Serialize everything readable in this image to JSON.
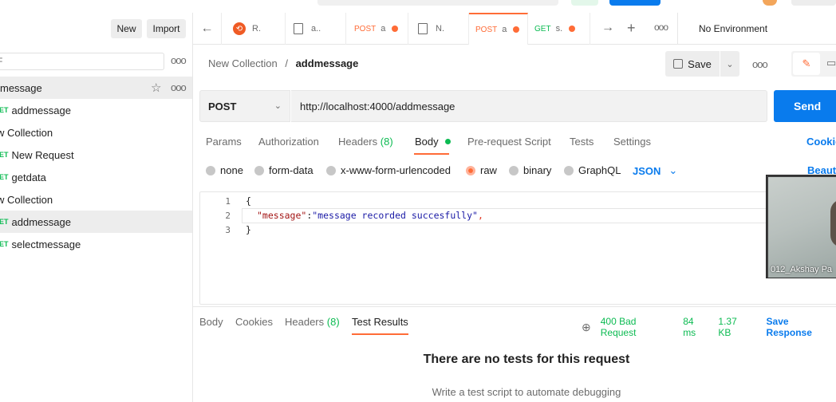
{
  "sidebar": {
    "new_label": "New",
    "import_label": "Import",
    "filter_glyph": "F",
    "more_glyph": "ooo",
    "items": [
      {
        "method": "",
        "label": "message",
        "selected": true
      },
      {
        "method": "GET",
        "label": "addmessage",
        "selected": false
      },
      {
        "method": "",
        "label": "w Collection",
        "selected": false
      },
      {
        "method": "GET",
        "label": "New Request",
        "selected": false
      },
      {
        "method": "GET",
        "label": "getdata",
        "selected": false
      },
      {
        "method": "",
        "label": "w Collection",
        "selected": false
      },
      {
        "method": "GET",
        "label": "addmessage",
        "selected": true
      },
      {
        "method": "GET",
        "label": "selectmessage",
        "selected": false
      }
    ]
  },
  "tabs": {
    "items": [
      {
        "method": "",
        "label": "R."
      },
      {
        "method": "",
        "label": "a.."
      },
      {
        "method": "POST",
        "label": "a"
      },
      {
        "method": "",
        "label": "N."
      },
      {
        "method": "POST",
        "label": "a"
      },
      {
        "method": "GET",
        "label": "s."
      }
    ],
    "environment": "No Environment"
  },
  "breadcrumb": {
    "collection": "New Collection",
    "separator": "/",
    "request": "addmessage"
  },
  "toolbar": {
    "save_label": "Save"
  },
  "request": {
    "method": "POST",
    "url": "http://localhost:4000/addmessage",
    "send_label": "Send",
    "tabs": {
      "params": "Params",
      "authorization": "Authorization",
      "headers": "Headers",
      "headers_count": "(8)",
      "body": "Body",
      "prerequest": "Pre-request Script",
      "tests": "Tests",
      "settings": "Settings"
    },
    "cookies_link": "Cookie",
    "beautify_link": "Beauti",
    "body_types": [
      "none",
      "form-data",
      "x-www-form-urlencoded",
      "raw",
      "binary",
      "GraphQL"
    ],
    "selected_body_type": "raw",
    "language": "JSON"
  },
  "editor": {
    "line_numbers": [
      "1",
      "2",
      "3"
    ],
    "open_brace": "{",
    "key": "\"message\"",
    "colon": ":",
    "value": "\"message recorded succesfully\"",
    "comma": ",",
    "close_brace": "}"
  },
  "response": {
    "tabs": {
      "body": "Body",
      "cookies": "Cookies",
      "headers": "Headers",
      "headers_count": "(8)",
      "test_results": "Test Results"
    },
    "status": "400 Bad Request",
    "time": "84 ms",
    "size": "1.37 KB",
    "save_label": "Save Response",
    "empty_title": "There are no tests for this request",
    "empty_subtitle": "Write a test script to automate debugging"
  },
  "video": {
    "participant": "012_Akshay Pa"
  },
  "colors": {
    "accent": "#ff6c37",
    "send": "#097bed",
    "success": "#0cbb52"
  }
}
